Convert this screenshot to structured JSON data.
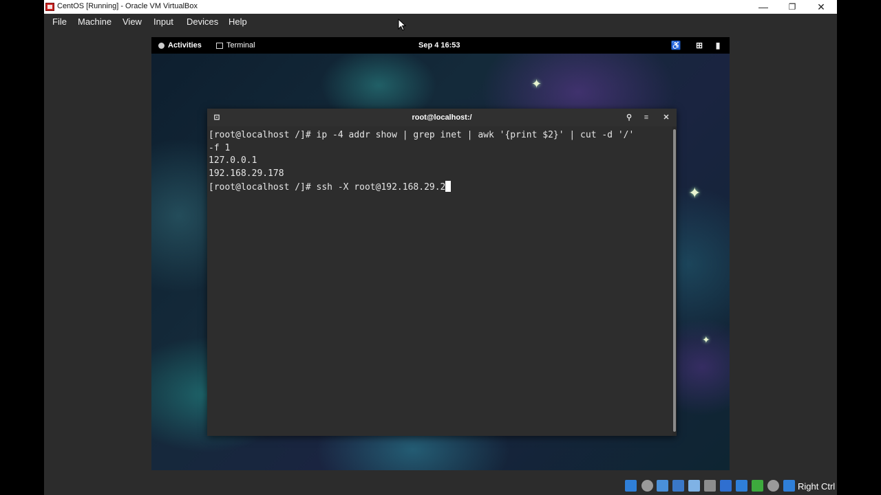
{
  "window": {
    "title": "CentOS [Running] - Oracle VM VirtualBox",
    "controls": {
      "minimize": "—",
      "maximize": "❐",
      "close": "✕"
    }
  },
  "menubar": {
    "items": [
      "File",
      "Machine",
      "View",
      "Input",
      "Devices",
      "Help"
    ]
  },
  "guest": {
    "topbar": {
      "activities": "Activities",
      "app": "Terminal",
      "clock": "Sep 4  16:53",
      "tray_icons": [
        "accessibility-icon",
        "network-icon",
        "battery-icon"
      ]
    },
    "terminal": {
      "title": "root@localhost:/",
      "lines": [
        "[root@localhost /]# ip -4 addr show | grep inet | awk '{print $2}' | cut -d '/'",
        "-f 1",
        "127.0.0.1",
        "192.168.29.178",
        "[root@localhost /]# ssh -X root@192.168.29.2"
      ]
    }
  },
  "statusbar": {
    "icons": [
      "hard-disk-icon",
      "optical-disk-icon",
      "audio-icon",
      "network-icon",
      "usb-icon",
      "shared-folder-icon",
      "display-icon",
      "video-capture-icon",
      "cpu-icon",
      "mouse-integration-icon",
      "keyboard-icon"
    ],
    "host_key": "Right Ctrl"
  }
}
